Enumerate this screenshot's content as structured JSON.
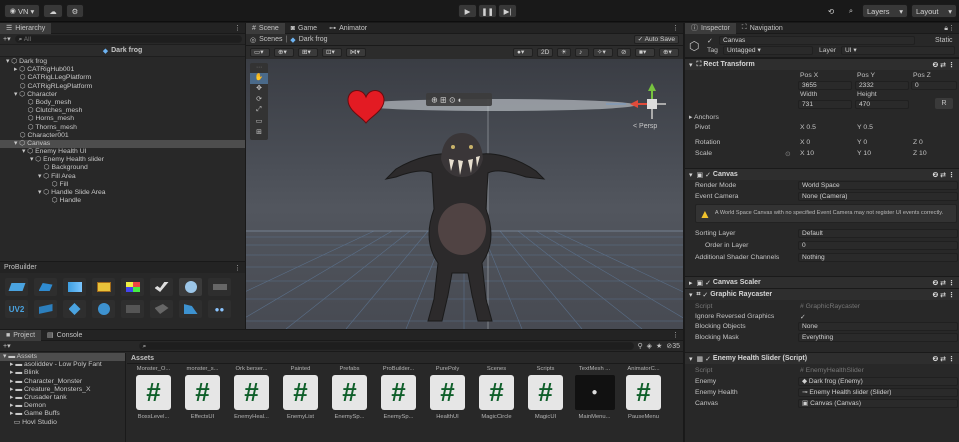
{
  "toolbar": {
    "account": "VN",
    "layers_label": "Layers",
    "layout_label": "Layout"
  },
  "hierarchy": {
    "tab": "Hierarchy",
    "search_placeholder": "All",
    "scene_name": "Dark frog",
    "items": [
      {
        "label": "Dark frog",
        "indent": 0,
        "expanded": true
      },
      {
        "label": "CATRigHub001",
        "indent": 1,
        "expanded": false
      },
      {
        "label": "CATRigLLegPlatform",
        "indent": 1,
        "expanded": null
      },
      {
        "label": "CATRigRLegPlatform",
        "indent": 1,
        "expanded": null
      },
      {
        "label": "Character",
        "indent": 1,
        "expanded": true
      },
      {
        "label": "Body_mesh",
        "indent": 2,
        "expanded": null
      },
      {
        "label": "Clutches_mesh",
        "indent": 2,
        "expanded": null
      },
      {
        "label": "Horns_mesh",
        "indent": 2,
        "expanded": null
      },
      {
        "label": "Thorns_mesh",
        "indent": 2,
        "expanded": null
      },
      {
        "label": "Character001",
        "indent": 1,
        "expanded": null
      },
      {
        "label": "Canvas",
        "indent": 1,
        "expanded": true,
        "selected": true
      },
      {
        "label": "Enemy Health UI",
        "indent": 2,
        "expanded": true
      },
      {
        "label": "Enemy Health slider",
        "indent": 3,
        "expanded": true
      },
      {
        "label": "Background",
        "indent": 4,
        "expanded": null
      },
      {
        "label": "Fill Area",
        "indent": 4,
        "expanded": true
      },
      {
        "label": "Fill",
        "indent": 5,
        "expanded": null
      },
      {
        "label": "Handle Slide Area",
        "indent": 4,
        "expanded": true
      },
      {
        "label": "Handle",
        "indent": 5,
        "expanded": null
      }
    ]
  },
  "probuilder": {
    "title": "ProBuilder"
  },
  "scene": {
    "tabs": [
      "Scene",
      "Game",
      "Animator"
    ],
    "breadcrumb_root": "Scenes",
    "breadcrumb_current": "Dark frog",
    "auto_save": "Auto Save",
    "view_2d": "2D",
    "persp": "< Persp"
  },
  "project": {
    "tabs": [
      "Project",
      "Console"
    ],
    "tree_root": "Assets",
    "tree_items": [
      "asoliddev - Low Poly Fant",
      "Blink",
      "Character_Monster",
      "Creature_Monsters_X",
      "Crusader tank",
      "Demon",
      "Game Buffs",
      "Hovl Studio"
    ],
    "breadcrumb": "Assets",
    "folders": [
      "Monster_O...",
      "monster_s...",
      "Ork berser...",
      "Painted",
      "Prefabs",
      "ProBuilder...",
      "PurePoly",
      "Scenes",
      "Scripts",
      "TextMesh ...",
      "AnimatorC..."
    ],
    "scripts": [
      "BossLevel...",
      "EffectsUI",
      "EnemyHeal...",
      "EnemyList",
      "EnemySp...",
      "EnemySp...",
      "HealthUI",
      "MagicCircle",
      "MagicUI",
      "MainMenu...",
      "PauseMenu"
    ],
    "count_badge": "35"
  },
  "inspector": {
    "tabs": [
      "Inspector",
      "Navigation"
    ],
    "object_name": "Canvas",
    "static_label": "Static",
    "tag_label": "Tag",
    "tag_value": "Untagged",
    "layer_label": "Layer",
    "layer_value": "UI",
    "rect_transform": {
      "title": "Rect Transform",
      "pos_headers": [
        "Pos X",
        "Pos Y",
        "Pos Z"
      ],
      "pos_values": [
        "3655",
        "2332",
        "0"
      ],
      "size_headers": [
        "Width",
        "Height"
      ],
      "size_values": [
        "731",
        "470"
      ],
      "anchors": "Anchors",
      "pivot_label": "Pivot",
      "pivot": [
        "0.5",
        "0.5"
      ],
      "rotation_label": "Rotation",
      "rotation": [
        "0",
        "0",
        "0"
      ],
      "scale_label": "Scale",
      "scale": [
        "10",
        "10",
        "10"
      ]
    },
    "canvas": {
      "title": "Canvas",
      "render_mode_label": "Render Mode",
      "render_mode": "World Space",
      "event_camera_label": "Event Camera",
      "event_camera": "None (Camera)",
      "warning": "A World Space Canvas with no specified Event Camera may not register UI events correctly.",
      "sorting_layer_label": "Sorting Layer",
      "sorting_layer": "Default",
      "order_label": "Order in Layer",
      "order": "0",
      "shader_label": "Additional Shader Channels",
      "shader": "Nothing"
    },
    "canvas_scaler": "Canvas Scaler",
    "graphic_raycaster": {
      "title": "Graphic Raycaster",
      "script_label": "Script",
      "script": "GraphicRaycaster",
      "ignore_label": "Ignore Reversed Graphics",
      "ignore": "✓",
      "blocking_objects_label": "Blocking Objects",
      "blocking_objects": "None",
      "blocking_mask_label": "Blocking Mask",
      "blocking_mask": "Everything"
    },
    "enemy_health_slider": {
      "title": "Enemy Health Slider (Script)",
      "script_label": "Script",
      "script": "EnemyHealthSlider",
      "enemy_label": "Enemy",
      "enemy": "Dark frog (Enemy)",
      "health_label": "Enemy Health",
      "health": "Enemy Health slider (Slider)",
      "canvas_label": "Canvas",
      "canvas": "Canvas (Canvas)"
    }
  }
}
